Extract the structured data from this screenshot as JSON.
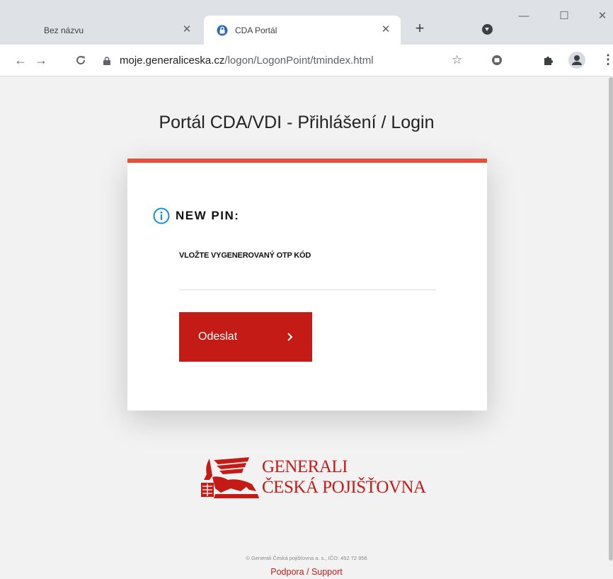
{
  "browser": {
    "tabs": [
      {
        "title": "Bez názvu",
        "active": false
      },
      {
        "title": "CDA Portál",
        "active": true
      }
    ],
    "url_host": "moje.generaliceska.cz",
    "url_path": "/logon/LogonPoint/tmindex.html"
  },
  "page": {
    "title": "Portál CDA/VDI - Přihlášení / Login",
    "form": {
      "heading": "NEW PIN:",
      "otp_label": "VLOŽTE VYGENEROVANÝ OTP KÓD",
      "otp_value": "",
      "submit_label": "Odeslat"
    },
    "logo": {
      "line1": "GENERALI",
      "line2": "ČESKÁ POJIŠŤOVNA"
    },
    "footer": {
      "copyright": "© Generali Česká pojišťovna a. s., IČO: 452 72 956",
      "support_link": "Podpora / Support"
    }
  },
  "colors": {
    "accent_bar": "#e3513a",
    "brand_red": "#c51b17",
    "info_icon": "#1a8fcf"
  },
  "icons": [
    "lock-icon",
    "info-icon",
    "chevron-right-icon",
    "generali-lion-logo",
    "star-icon",
    "extensions-icon",
    "profile-icon",
    "menu-icon"
  ]
}
